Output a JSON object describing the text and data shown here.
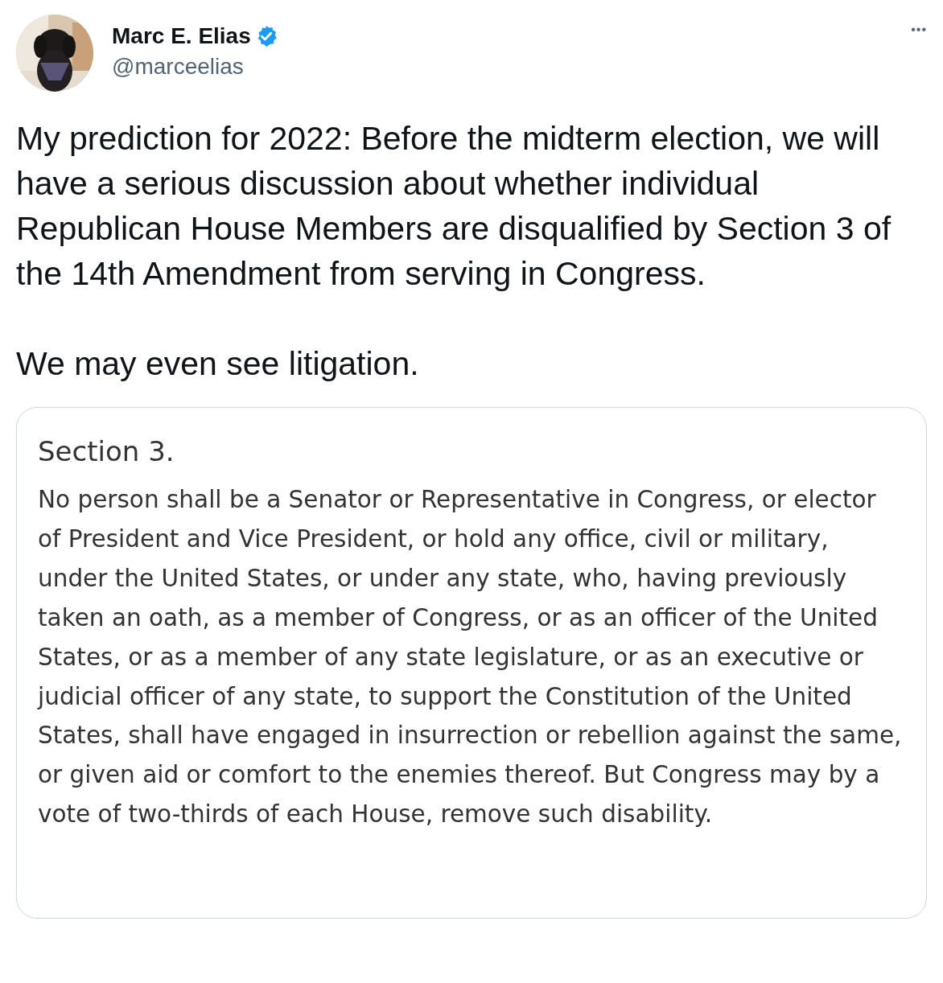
{
  "author": {
    "name": "Marc E. Elias",
    "verified": true,
    "handle": "@marceelias"
  },
  "more_icon": "•••",
  "tweet_paragraphs": [
    "My prediction for 2022: Before the midterm election, we will have a serious discussion about whether individual Republican House Members are disqualified by Section 3 of the 14th Amendment from serving in Congress.",
    "We may even see litigation."
  ],
  "attached_image": {
    "heading": "Section 3.",
    "body": "No person shall be a Senator or Representative in Congress, or elector of President and Vice President, or hold any office, civil or military, under the United States, or under any state, who, having previously taken an oath, as a member of Congress, or as an officer of the United States, or as a member of any state legislature, or as an executive or judicial officer of any state, to support the Constitution of the United States, shall have engaged in insurrection or rebellion against the same, or given aid or comfort to the enemies thereof. But Congress may by a vote of two-thirds of each House, remove such disability."
  }
}
